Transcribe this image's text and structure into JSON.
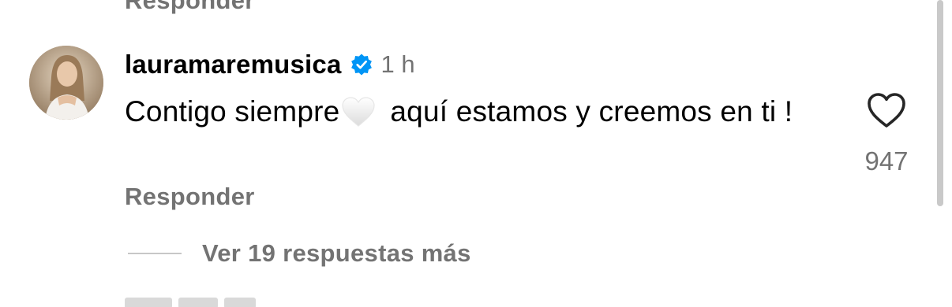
{
  "previous_comment": {
    "reply_label": "Responder"
  },
  "comment": {
    "username": "lauramaremusica",
    "verified_icon": "verified-badge-icon",
    "time_ago": "1 h",
    "text_before_emoji": "Contigo siempre",
    "emoji": "white-heart",
    "text_after_emoji": "aquí estamos y creemos en ti !",
    "likes": "947",
    "like_icon": "heart-outline-icon",
    "reply_label": "Responder",
    "view_replies_label": "Ver 19 respuestas más"
  },
  "colors": {
    "secondary_text": "#737373",
    "verified_blue": "#0095f6",
    "divider": "#c7c7c7"
  }
}
